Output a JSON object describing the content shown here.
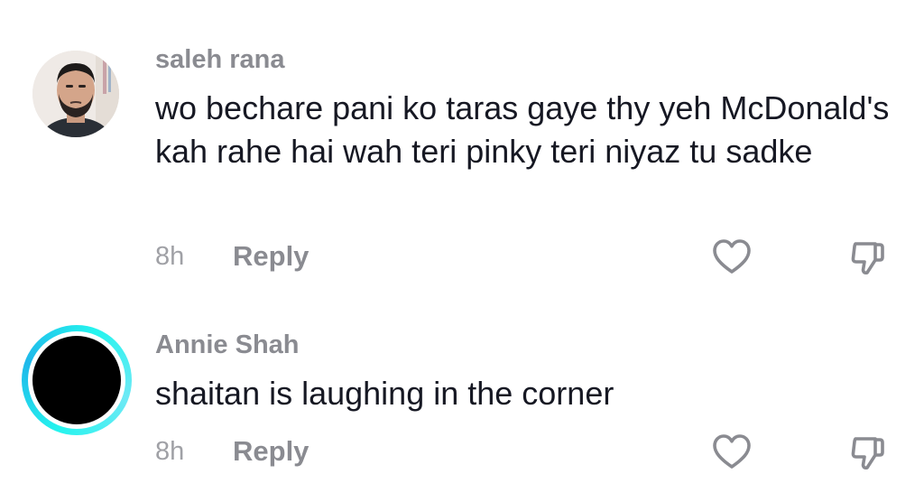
{
  "comments": [
    {
      "username": "saleh rana",
      "text": "wo bechare pani ko taras gaye thy yeh McDonald's kah rahe hai wah teri pinky teri niyaz tu sadke",
      "time": "8h",
      "reply_label": "Reply",
      "avatar": "profile-photo"
    },
    {
      "username": "Annie Shah",
      "text": "shaitan is laughing in the corner",
      "time": "8h",
      "reply_label": "Reply",
      "avatar": "black-circle-with-cyan-ring"
    }
  ],
  "icons": {
    "like": "heart-outline-icon",
    "dislike": "thumbs-down-outline-icon"
  },
  "colors": {
    "username": "#8a8b91",
    "text": "#161823",
    "story_ring": "#25f4ee"
  }
}
